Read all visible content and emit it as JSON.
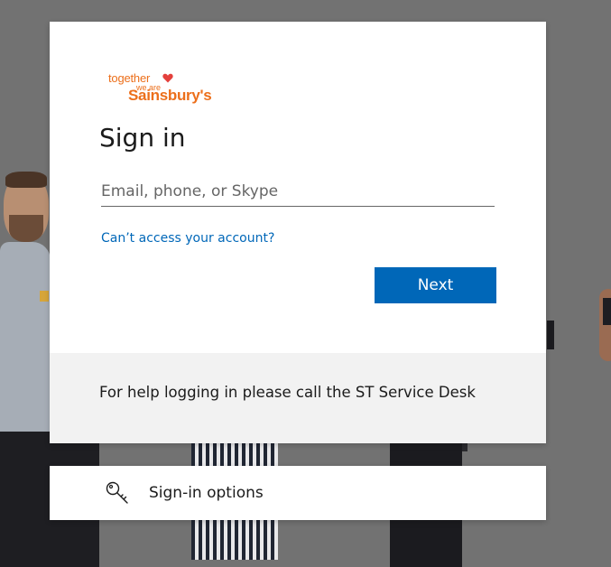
{
  "logo": {
    "line1": "together",
    "line2": "we are",
    "brand": "Sainsbury's",
    "heart_color": "#e4403c",
    "brand_color": "#ec6f1b"
  },
  "signin": {
    "title": "Sign in",
    "email_placeholder": "Email, phone, or Skype",
    "email_value": "",
    "cant_access": "Can’t access your account?",
    "next": "Next"
  },
  "help": {
    "text": "For help logging in please call the ST Service Desk"
  },
  "options": {
    "icon": "key-icon",
    "label": "Sign-in options"
  },
  "colors": {
    "accent": "#0067b8",
    "background": "#727272",
    "panel": "#f2f2f2"
  }
}
